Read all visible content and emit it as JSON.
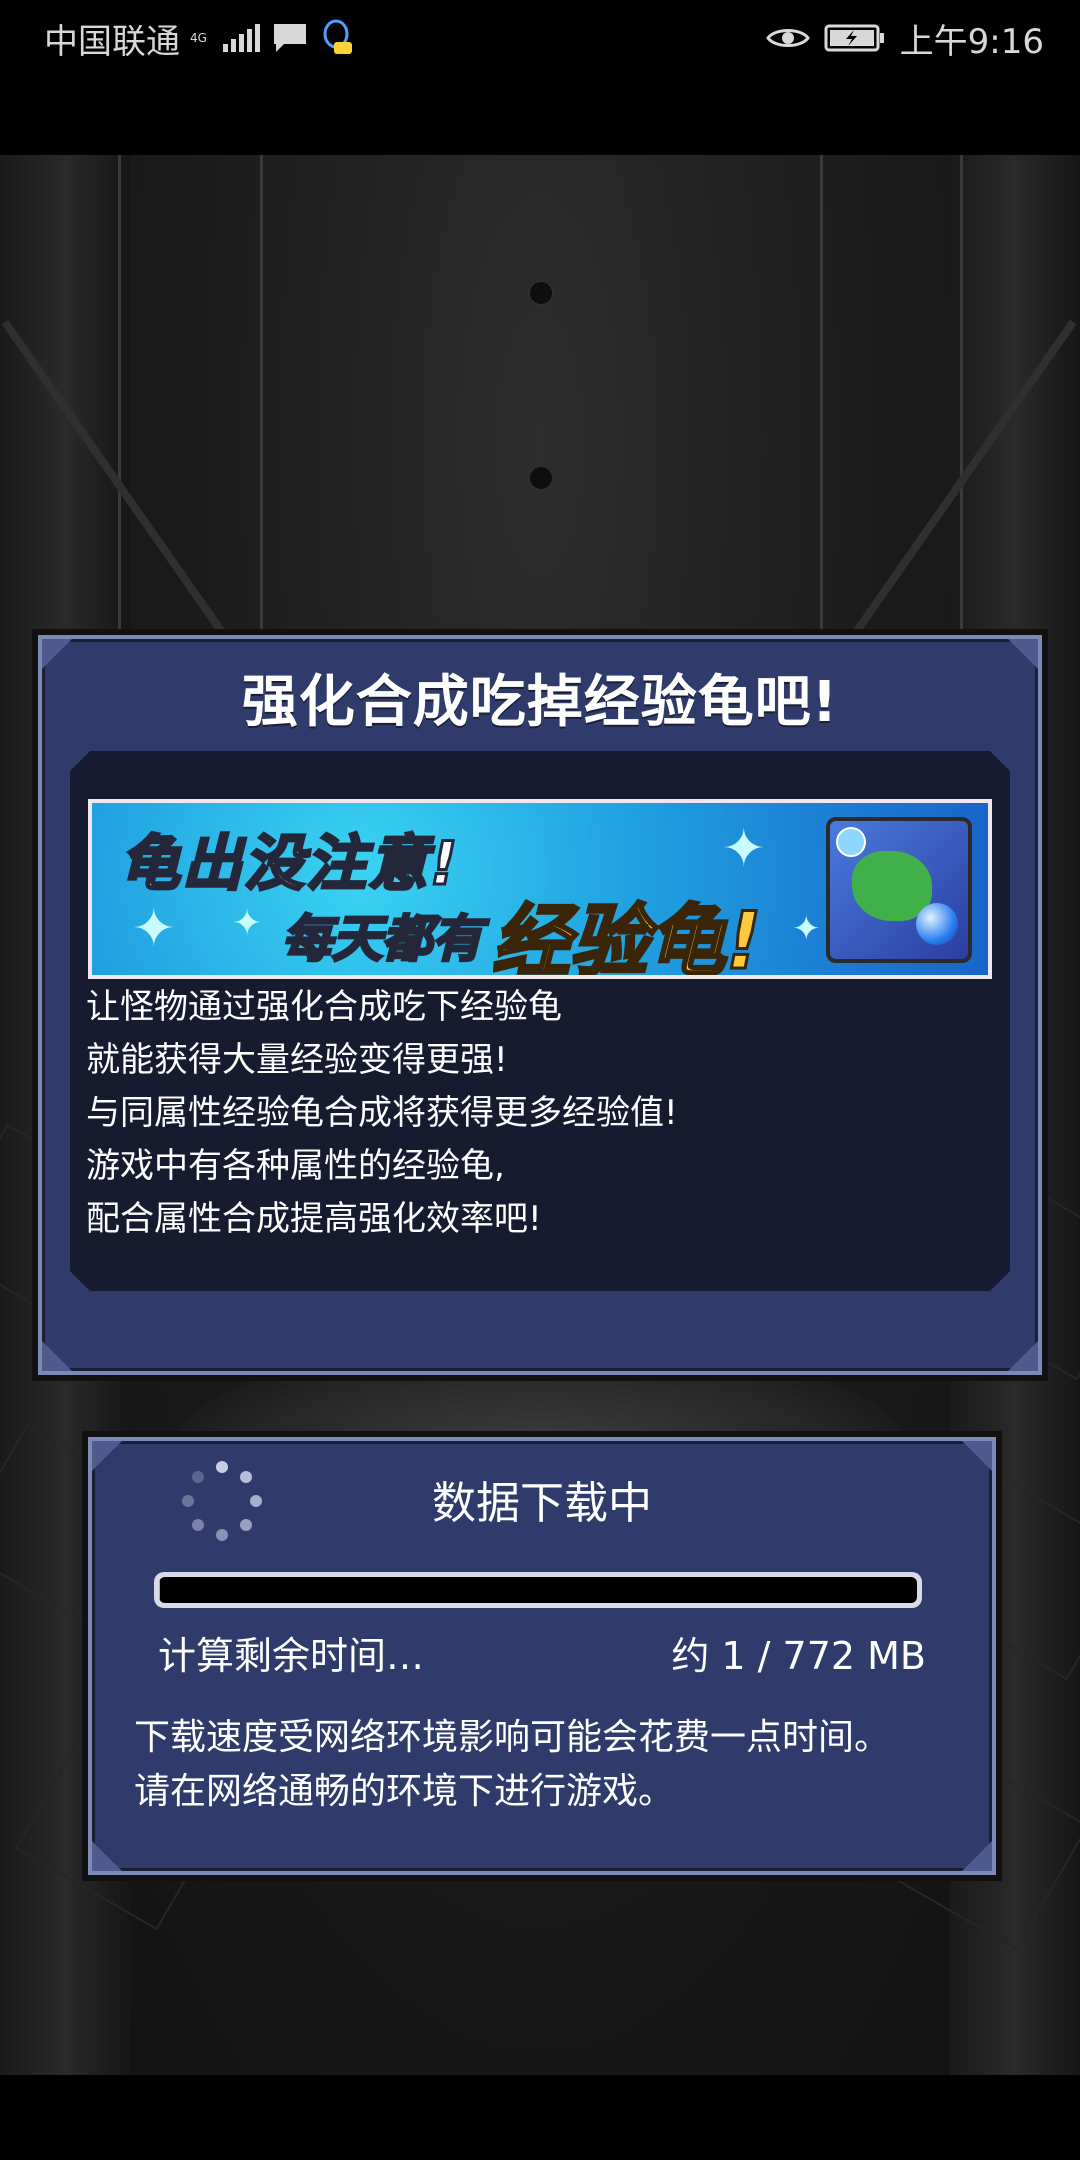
{
  "status_bar": {
    "carrier": "中国联通",
    "network": "4G",
    "time": "上午9:16",
    "icons": [
      "signal-icon",
      "message-icon",
      "qq-icon",
      "eye-icon",
      "battery-icon"
    ]
  },
  "notice": {
    "title": "强化合成吃掉经验龟吧!",
    "banner": {
      "line1": "龟出没注意!",
      "line2_prefix": "每天都有",
      "line2_highlight": "经验龟!"
    },
    "description": [
      "让怪物通过强化合成吃下经验龟",
      "就能获得大量经验变得更强!",
      "与同属性经验龟合成将获得更多经验值!",
      "游戏中有各种属性的经验龟,",
      "配合属性合成提高强化效率吧!"
    ]
  },
  "download": {
    "title": "数据下载中",
    "progress": 0.0013,
    "remaining_label": "计算剩余时间…",
    "size_label": "约 1 / 772 MB",
    "notes": [
      "下载速度受网络环境影响可能会花费一点时间。",
      "请在网络通畅的环境下进行游戏。"
    ]
  },
  "colors": {
    "panel": "#2e3b6b",
    "panel_border": "#7d8ab5",
    "inner": "#161b30",
    "progress_fill": "#5dc8ff"
  }
}
